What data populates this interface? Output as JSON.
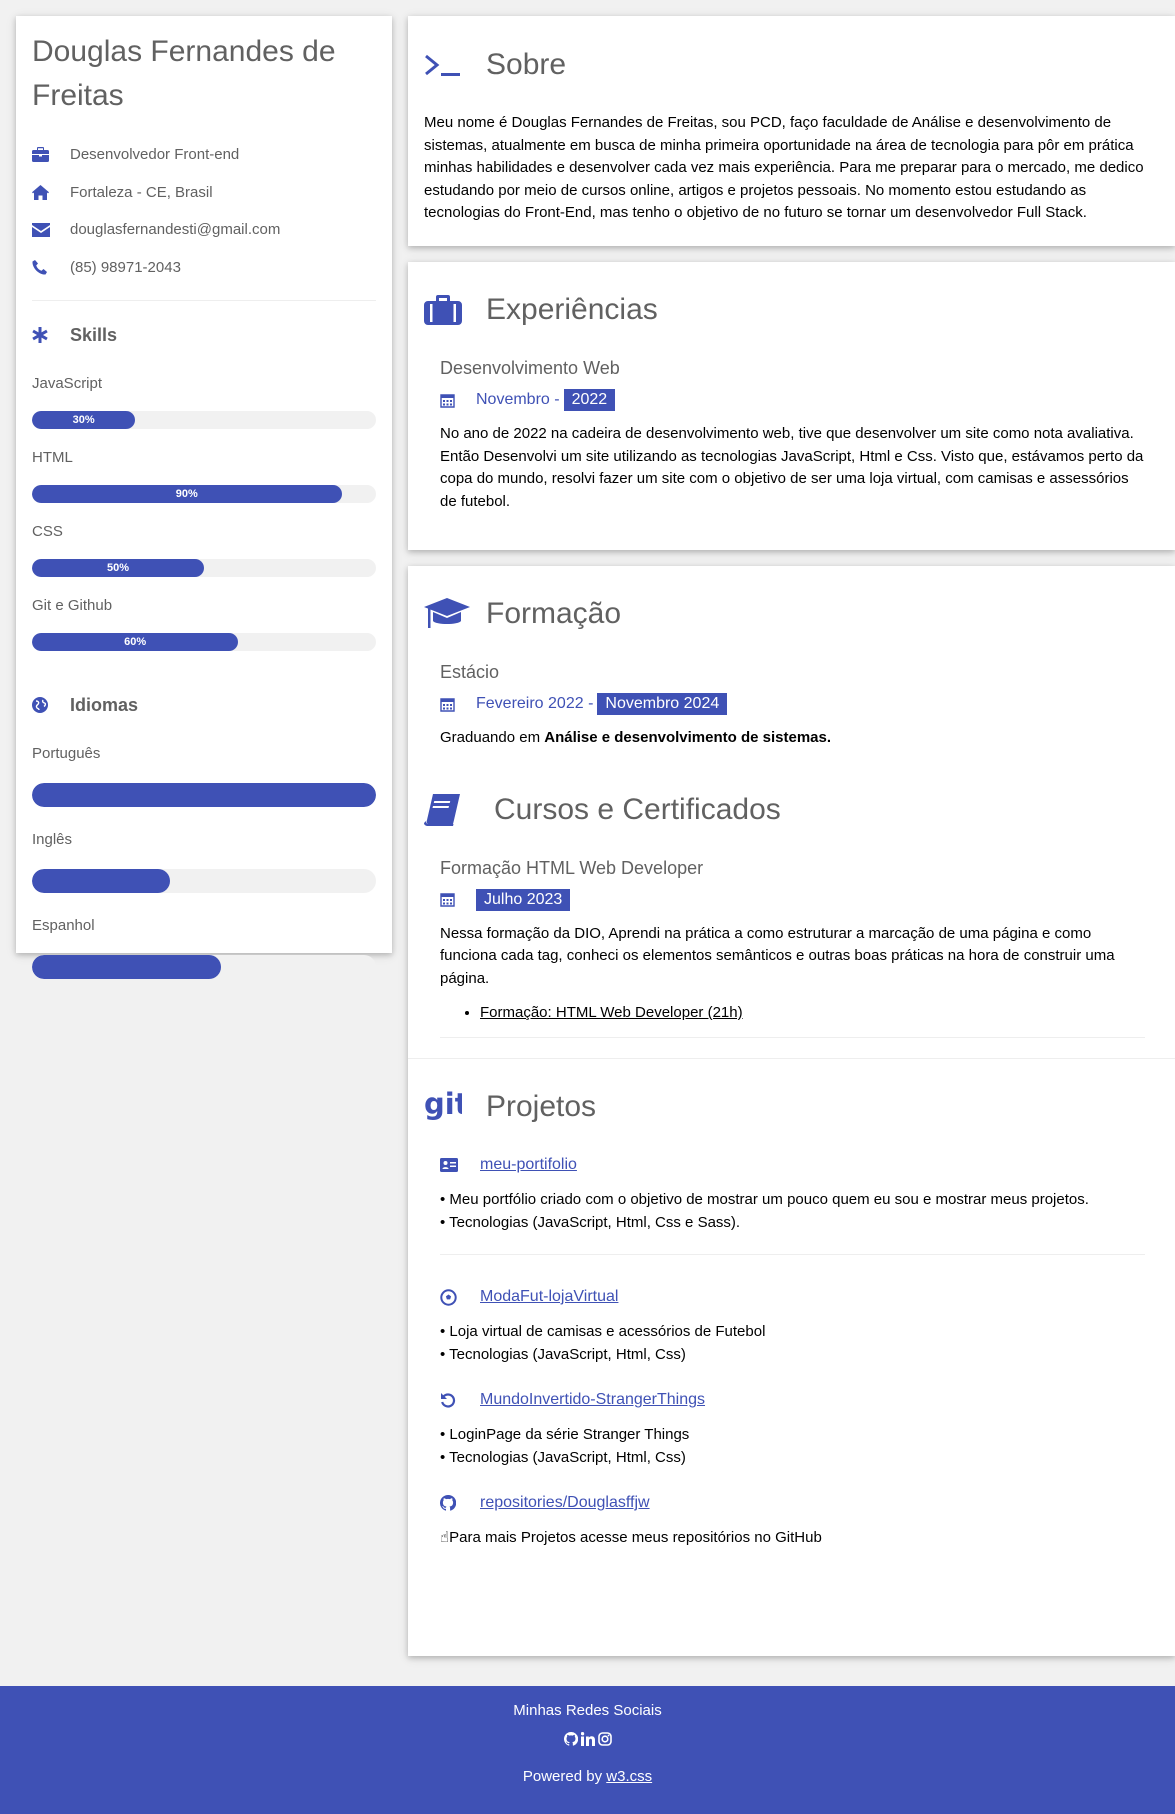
{
  "profile": {
    "name": "Douglas Fernandes de Freitas",
    "job": "Desenvolvedor Front-end",
    "location": "Fortaleza - CE, Brasil",
    "email": "douglasfernandesti@gmail.com",
    "phone": "(85) 98971-2043"
  },
  "skills": {
    "title": "Skills",
    "items": [
      {
        "label": "JavaScript",
        "percent_text": "30%",
        "percent": 30
      },
      {
        "label": "HTML",
        "percent_text": "90%",
        "percent": 90
      },
      {
        "label": "CSS",
        "percent_text": "50%",
        "percent": 50
      },
      {
        "label": "Git e Github",
        "percent_text": "60%",
        "percent": 60
      }
    ]
  },
  "languages": {
    "title": "Idiomas",
    "items": [
      {
        "label": "Português",
        "level": 100
      },
      {
        "label": "Inglês",
        "level": 40
      },
      {
        "label": "Espanhol",
        "level": 55
      }
    ]
  },
  "about": {
    "title": "Sobre",
    "text": "Meu nome é Douglas Fernandes de Freitas, sou PCD, faço faculdade de Análise e desenvolvimento de sistemas, atualmente em busca de minha primeira oportunidade na área de tecnologia para pôr em prática minhas habilidades e desenvolver cada vez mais experiência. Para me preparar para o mercado, me dedico estudando por meio de cursos online, artigos e projetos pessoais. No momento estou estudando as tecnologias do Front-End, mas tenho o objetivo de no futuro se tornar um desenvolvedor Full Stack."
  },
  "experience": {
    "title": "Experiências",
    "item_title": "Desenvolvimento Web",
    "date_start": "Novembro -",
    "date_tag": "2022",
    "text": "No ano de 2022 na cadeira de desenvolvimento web, tive que desenvolver um site como nota avaliativa. Então Desenvolvi um site utilizando as tecnologias JavaScript, Html e Css. Visto que, estávamos perto da copa do mundo, resolvi fazer um site com o objetivo de ser uma loja virtual, com camisas e assessórios de futebol."
  },
  "education": {
    "title": "Formação",
    "item_title": "Estácio",
    "date_start": "Fevereiro 2022 -",
    "date_tag": "Novembro 2024",
    "text_prefix": "Graduando em ",
    "text_bold": "Análise e desenvolvimento de sistemas."
  },
  "courses": {
    "title": "Cursos e Certificados",
    "item_title": "Formação HTML Web Developer",
    "date_tag": "Julho 2023",
    "text": "Nessa formação da DIO, Aprendi na prática a como estruturar a marcação de uma página e como funciona cada tag, conheci os elementos semânticos e outras boas práticas na hora de construir uma página.",
    "link": "Formação: HTML Web Developer (21h)"
  },
  "projects": {
    "title": "Projetos",
    "items": [
      {
        "name": "meu-portifolio",
        "icon": "id-card-icon",
        "line1": "• Meu portfólio criado com o objetivo de mostrar um pouco quem eu sou e mostrar meus projetos.",
        "line2": "• Tecnologias (JavaScript, Html, Css e Sass)."
      },
      {
        "name": "ModaFut-lojaVirtual",
        "icon": "soccer-ball-icon",
        "line1": "• Loja virtual de camisas e acessórios de Futebol",
        "line2": "• Tecnologias (JavaScript, Html, Css)"
      },
      {
        "name": "MundoInvertido-StrangerThings",
        "icon": "undo-icon",
        "line1": "• LoginPage da série Stranger Things",
        "line2": "• Tecnologias (JavaScript, Html, Css)"
      },
      {
        "name": "repositories/Douglasffjw",
        "icon": "github-icon",
        "line1": "Para mais Projetos acesse meus repositórios no GitHub"
      }
    ]
  },
  "footer": {
    "title": "Minhas Redes Sociais",
    "powered_prefix": "Powered by ",
    "powered_link": "w3.css"
  },
  "colors": {
    "accent": "#3f51b5",
    "text_muted": "#616161",
    "background": "#f1f1f1"
  }
}
